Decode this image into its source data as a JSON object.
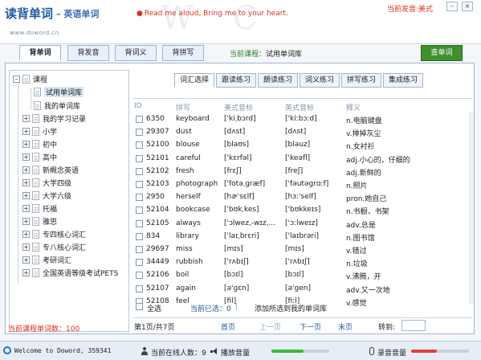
{
  "header": {
    "logo_title": "读背单词",
    "logo_sub": "– 英语单词",
    "slogan": "Read me aloud, Bring me to your heart.",
    "site_url": "www.doword.cn",
    "voice_label": "当前发音:美式",
    "win_min": "–",
    "win_close": "×"
  },
  "topbar": {
    "tabs": [
      "背单词",
      "背发音",
      "背词义",
      "背拼写"
    ],
    "course_prefix": "当前课程：",
    "course_name": "试用单词库",
    "lookup_button": "查单词"
  },
  "sidebar": {
    "root": "课程",
    "items": [
      "试用单词库",
      "我的单词库",
      "我的学习记录",
      "小学",
      "初中",
      "高中",
      "新概念英语",
      "大学四级",
      "大学六级",
      "托福",
      "雅思",
      "专四核心词汇",
      "专八核心词汇",
      "考研词汇",
      "全国英语等级考试PETS"
    ]
  },
  "subtabs": [
    "词汇选择",
    "跟读练习",
    "朗读练习",
    "词义练习",
    "拼写练习",
    "集成练习"
  ],
  "table": {
    "headers": {
      "id": "ID",
      "word": "拼写",
      "us": "美式音标",
      "uk": "英式音标",
      "def": "释义"
    },
    "rows": [
      {
        "id": "6350",
        "word": "keyboard",
        "us": "['kiˌbɔrd]",
        "uk": "['kiːbɔːd]",
        "def": "n.电脑键盘"
      },
      {
        "id": "29307",
        "word": "dust",
        "us": "[dʌst]",
        "uk": "[dʌst]",
        "def": "v.掸掉灰尘"
      },
      {
        "id": "52100",
        "word": "blouse",
        "us": "[blaʊs]",
        "uk": "[blauz]",
        "def": "n.女衬衫"
      },
      {
        "id": "52101",
        "word": "careful",
        "us": "['kɛrfəl]",
        "uk": "['keəfl]",
        "def": "adj.小心的，仔细的"
      },
      {
        "id": "52102",
        "word": "fresh",
        "us": "[frɛʃ]",
        "uk": "[freʃ]",
        "def": "adj.新鲜的"
      },
      {
        "id": "52103",
        "word": "photograph",
        "us": "['fotəˌgræf]",
        "uk": "['fəutəgrɑːf]",
        "def": "n.照片"
      },
      {
        "id": "2950",
        "word": "herself",
        "us": "[hɚ'sɛlf]",
        "uk": "[hɜː'self]",
        "def": "pron.她自己"
      },
      {
        "id": "52104",
        "word": "bookcase",
        "us": "['bʊkˌkes]",
        "uk": "['bʊkkeɪs]",
        "def": "n.书橱，书架"
      },
      {
        "id": "52105",
        "word": "always",
        "us": "['ɔlwez,-wɪz,...",
        "uk": "['ɔːlweɪz]",
        "def": "adv.总是"
      },
      {
        "id": "834",
        "word": "library",
        "us": "['laɪˌbrɛri]",
        "uk": "['laɪbrəri]",
        "def": "n.图书馆"
      },
      {
        "id": "29697",
        "word": "miss",
        "us": "[mɪs]",
        "uk": "[mɪs]",
        "def": "v.错过"
      },
      {
        "id": "34449",
        "word": "rubbish",
        "us": "['rʌbɪʃ]",
        "uk": "['rʌbɪʃ]",
        "def": "n.垃圾"
      },
      {
        "id": "52106",
        "word": "boil",
        "us": "[bɔɪl]",
        "uk": "[bɔɪl]",
        "def": "v.沸腾，开"
      },
      {
        "id": "52107",
        "word": "again",
        "us": "[ə'gɛn]",
        "uk": "[ə'gen]",
        "def": "adv.又一次地"
      },
      {
        "id": "52108",
        "word": "feel",
        "us": "[fil]",
        "uk": "[fiːl]",
        "def": "v.感觉"
      }
    ]
  },
  "select_bar": {
    "select_all": "全选",
    "selected_label": "当前已选：0",
    "add_label": "添加所选到我的单词库"
  },
  "pager": {
    "page_info": "第1页/共7页",
    "first": "首页",
    "prev": "上一页",
    "next": "下一页",
    "last": "末页",
    "goto": "转到:"
  },
  "course_count": "当前课程单词数：100",
  "statusbar": {
    "welcome": "Welcome to Doword, 359341",
    "online": "当前在线人数：9",
    "play_volume": "播放音量",
    "record_volume": "录音音量"
  },
  "levels": {
    "play_volume": 0.55,
    "record_volume": 0.45
  },
  "colors": {
    "brand_blue": "#1e5aa0",
    "accent_red": "#e03020",
    "lookup_green": "#3f8f2c",
    "volume_green": "#3bb83a",
    "volume_red": "#e0403a"
  }
}
